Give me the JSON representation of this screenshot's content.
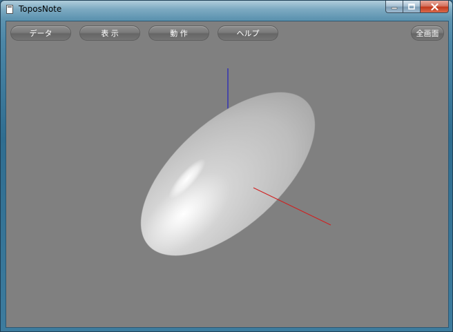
{
  "window": {
    "title": "ToposNote"
  },
  "toolbar": {
    "data_label": "データ",
    "view_label": "表 示",
    "action_label": "動 作",
    "help_label": "ヘルプ",
    "fullscreen_label": "全画面"
  },
  "icons": {
    "app": "document-icon",
    "minimize": "minimize-icon",
    "maximize": "maximize-icon",
    "close": "close-icon"
  },
  "colors": {
    "viewport_background": "#808080",
    "axis_vertical": "#2020c0",
    "axis_horizontal": "#d02020",
    "ellipsoid": "#c8c8c8"
  }
}
